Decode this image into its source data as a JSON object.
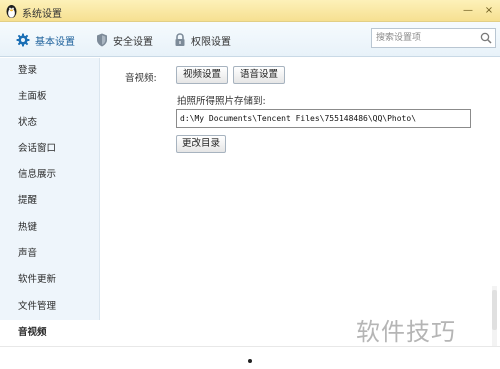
{
  "window": {
    "title": "系统设置",
    "minimize_glyph": "—",
    "close_glyph": "×",
    "title_icon": "qq-penguin-icon"
  },
  "nav": {
    "tabs": [
      {
        "label": "基本设置",
        "icon": "gear-icon",
        "active": true
      },
      {
        "label": "安全设置",
        "icon": "shield-icon",
        "active": false
      },
      {
        "label": "权限设置",
        "icon": "lock-icon",
        "active": false
      }
    ],
    "search_placeholder": "搜索设置项"
  },
  "sidebar": {
    "items": [
      {
        "label": "登录"
      },
      {
        "label": "主面板"
      },
      {
        "label": "状态"
      },
      {
        "label": "会话窗口"
      },
      {
        "label": "信息展示"
      },
      {
        "label": "提醒"
      },
      {
        "label": "热键"
      },
      {
        "label": "声音"
      },
      {
        "label": "软件更新"
      },
      {
        "label": "文件管理"
      },
      {
        "label": "音视频",
        "active": true
      }
    ]
  },
  "content": {
    "section_label": "音视频:",
    "video_settings_button": "视频设置",
    "audio_settings_button": "语音设置",
    "photo_path_label": "拍照所得照片存储到:",
    "photo_path_value": "d:\\My Documents\\Tencent Files\\755148486\\QQ\\Photo\\",
    "change_dir_button": "更改目录"
  },
  "watermark": "软件技巧",
  "colors": {
    "titlebar": "#f6e091",
    "accent_blue": "#1b5f9a",
    "sidebar_bg": "#eef5fb"
  }
}
